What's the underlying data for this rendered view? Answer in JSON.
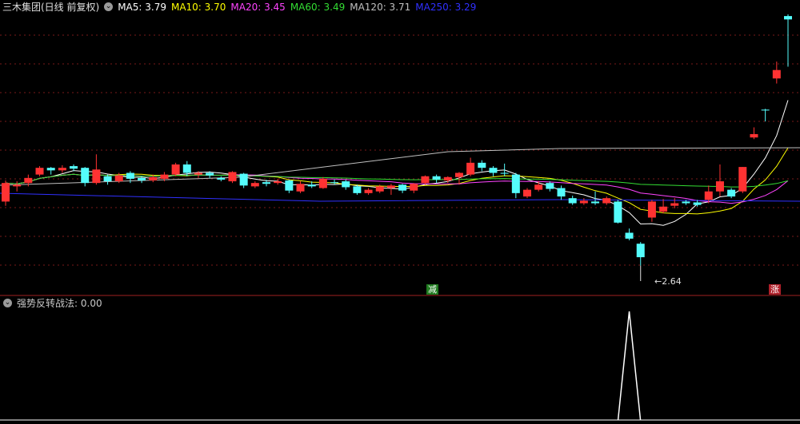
{
  "main_header": {
    "title": "三木集团(日线 前复权)",
    "settings_icon": "chevron-down-icon",
    "ma": [
      {
        "label": "MA5: 3.79",
        "color": "#ffffff"
      },
      {
        "label": "MA10: 3.70",
        "color": "#ffff00"
      },
      {
        "label": "MA20: 3.45",
        "color": "#ff44ff"
      },
      {
        "label": "MA60: 3.49",
        "color": "#33dd33"
      },
      {
        "label": "MA120: 3.71",
        "color": "#c0c0c0"
      },
      {
        "label": "MA250: 3.29",
        "color": "#3030ff"
      }
    ]
  },
  "low_marker": {
    "label": "←2.64"
  },
  "signals": {
    "reduce": {
      "label": "减",
      "color": "#1f7a1f"
    },
    "rise": {
      "label": "涨",
      "color": "#b0202a"
    }
  },
  "sub_header": {
    "title": "强势反转战法",
    "value": ": 0.00",
    "settings_icon": "chevron-down-icon"
  },
  "colors": {
    "up": "#ff3232",
    "down": "#54fcfc",
    "grid": "#7a1a1a",
    "divider": "#a02020"
  },
  "candles": [
    [
      3.4,
      3.62,
      3.35,
      3.65
    ],
    [
      3.58,
      3.6,
      3.52,
      3.64
    ],
    [
      3.62,
      3.68,
      3.58,
      3.72
    ],
    [
      3.72,
      3.8,
      3.7,
      3.82
    ],
    [
      3.8,
      3.77,
      3.72,
      3.81
    ],
    [
      3.77,
      3.8,
      3.74,
      3.83
    ],
    [
      3.82,
      3.79,
      3.76,
      3.84
    ],
    [
      3.8,
      3.62,
      3.58,
      3.81
    ],
    [
      3.62,
      3.78,
      3.6,
      3.96
    ],
    [
      3.7,
      3.64,
      3.6,
      3.72
    ],
    [
      3.64,
      3.71,
      3.62,
      3.74
    ],
    [
      3.74,
      3.67,
      3.62,
      3.76
    ],
    [
      3.68,
      3.65,
      3.62,
      3.7
    ],
    [
      3.65,
      3.69,
      3.63,
      3.72
    ],
    [
      3.67,
      3.72,
      3.64,
      3.75
    ],
    [
      3.72,
      3.84,
      3.7,
      3.86
    ],
    [
      3.84,
      3.74,
      3.7,
      3.88
    ],
    [
      3.72,
      3.74,
      3.68,
      3.76
    ],
    [
      3.74,
      3.71,
      3.68,
      3.76
    ],
    [
      3.68,
      3.66,
      3.64,
      3.7
    ],
    [
      3.64,
      3.75,
      3.62,
      3.76
    ],
    [
      3.73,
      3.59,
      3.56,
      3.74
    ],
    [
      3.58,
      3.62,
      3.56,
      3.64
    ],
    [
      3.63,
      3.61,
      3.58,
      3.66
    ],
    [
      3.62,
      3.64,
      3.6,
      3.67
    ],
    [
      3.65,
      3.53,
      3.5,
      3.66
    ],
    [
      3.52,
      3.61,
      3.5,
      3.64
    ],
    [
      3.6,
      3.58,
      3.56,
      3.64
    ],
    [
      3.56,
      3.67,
      3.55,
      3.69
    ],
    [
      3.63,
      3.62,
      3.6,
      3.66
    ],
    [
      3.64,
      3.57,
      3.54,
      3.66
    ],
    [
      3.58,
      3.5,
      3.48,
      3.6
    ],
    [
      3.5,
      3.54,
      3.48,
      3.56
    ],
    [
      3.52,
      3.58,
      3.5,
      3.6
    ],
    [
      3.56,
      3.59,
      3.48,
      3.61
    ],
    [
      3.6,
      3.53,
      3.5,
      3.61
    ],
    [
      3.53,
      3.61,
      3.5,
      3.62
    ],
    [
      3.62,
      3.7,
      3.6,
      3.71
    ],
    [
      3.7,
      3.66,
      3.62,
      3.72
    ],
    [
      3.65,
      3.69,
      3.62,
      3.7
    ],
    [
      3.69,
      3.74,
      3.6,
      3.75
    ],
    [
      3.72,
      3.86,
      3.7,
      3.92
    ],
    [
      3.86,
      3.8,
      3.76,
      3.89
    ],
    [
      3.8,
      3.74,
      3.7,
      3.82
    ],
    [
      3.74,
      3.73,
      3.7,
      3.85
    ],
    [
      3.72,
      3.5,
      3.44,
      3.74
    ],
    [
      3.46,
      3.54,
      3.44,
      3.56
    ],
    [
      3.54,
      3.6,
      3.52,
      3.64
    ],
    [
      3.62,
      3.55,
      3.52,
      3.64
    ],
    [
      3.56,
      3.46,
      3.42,
      3.59
    ],
    [
      3.44,
      3.38,
      3.36,
      3.47
    ],
    [
      3.38,
      3.41,
      3.36,
      3.44
    ],
    [
      3.4,
      3.38,
      3.36,
      3.52
    ],
    [
      3.38,
      3.44,
      3.36,
      3.46
    ],
    [
      3.4,
      3.15,
      3.14,
      3.42
    ],
    [
      3.03,
      2.96,
      2.94,
      3.08
    ],
    [
      2.9,
      2.74,
      2.64,
      2.92
    ],
    [
      3.21,
      3.4,
      3.16,
      3.42
    ],
    [
      3.28,
      3.34,
      3.26,
      3.43
    ],
    [
      3.35,
      3.38,
      3.32,
      3.44
    ],
    [
      3.4,
      3.38,
      3.36,
      3.42
    ],
    [
      3.39,
      3.36,
      3.34,
      3.42
    ],
    [
      3.42,
      3.52,
      3.38,
      3.59
    ],
    [
      3.52,
      3.64,
      3.46,
      3.84
    ],
    [
      3.54,
      3.46,
      3.44,
      3.56
    ],
    [
      3.52,
      3.81,
      3.5,
      3.81
    ],
    [
      4.16,
      4.2,
      4.14,
      4.28
    ],
    [
      4.49,
      4.48,
      4.35,
      4.5
    ],
    [
      4.86,
      4.96,
      4.8,
      5.06
    ],
    [
      5.6,
      5.56,
      5.0,
      5.62
    ]
  ],
  "indicator": {
    "baseline": 0,
    "peak_index": 55,
    "peak_value": 1
  }
}
